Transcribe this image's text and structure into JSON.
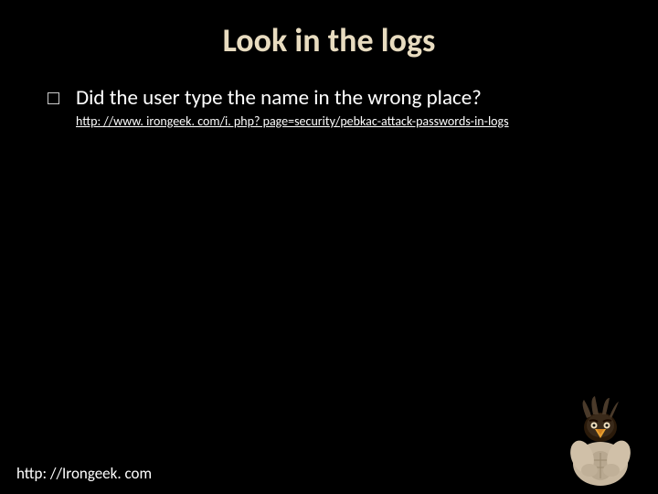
{
  "slide": {
    "title": "Look in the logs",
    "bullet": "Did the user type the name in the wrong place?",
    "link": "http: //www. irongeek. com/i. php? page=security/pebkac-attack-passwords-in-logs",
    "footer": "http: //Irongeek. com"
  }
}
